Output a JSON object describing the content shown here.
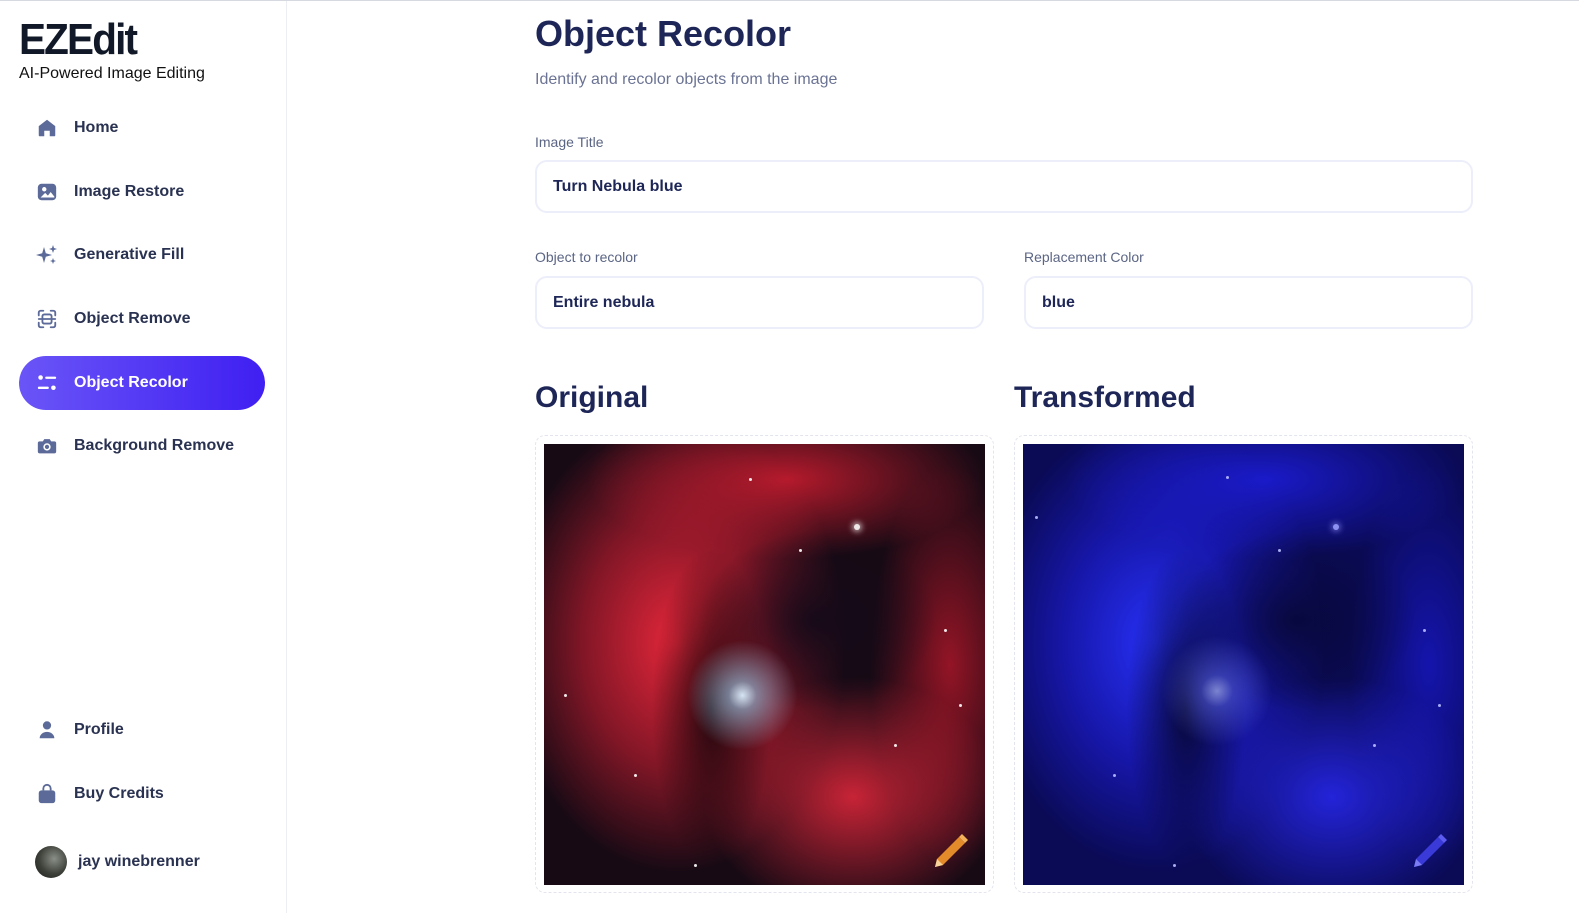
{
  "brand": {
    "logo": "EZEdit",
    "tagline": "AI-Powered Image Editing"
  },
  "sidebar": {
    "items": [
      {
        "label": "Home",
        "icon": "home-icon"
      },
      {
        "label": "Image Restore",
        "icon": "image-icon"
      },
      {
        "label": "Generative Fill",
        "icon": "sparkles-icon"
      },
      {
        "label": "Object Remove",
        "icon": "scan-object-icon"
      },
      {
        "label": "Object Recolor",
        "icon": "sliders-icon",
        "active": true
      },
      {
        "label": "Background Remove",
        "icon": "camera-icon"
      }
    ],
    "bottom_items": [
      {
        "label": "Profile",
        "icon": "user-icon"
      },
      {
        "label": "Buy Credits",
        "icon": "shopping-bag-icon"
      }
    ],
    "user": {
      "name": "jay winebrenner"
    }
  },
  "main": {
    "title": "Object Recolor",
    "subtitle": "Identify and recolor objects from the image",
    "fields": {
      "image_title": {
        "label": "Image Title",
        "value": "Turn Nebula blue"
      },
      "object": {
        "label": "Object to recolor",
        "value": "Entire nebula"
      },
      "color": {
        "label": "Replacement Color",
        "value": "blue"
      }
    },
    "original_title": "Original",
    "transformed_title": "Transformed"
  },
  "colors": {
    "accent_start": "#6a55f7",
    "accent_end": "#3f1ff2",
    "text_dark": "#1d2657"
  }
}
